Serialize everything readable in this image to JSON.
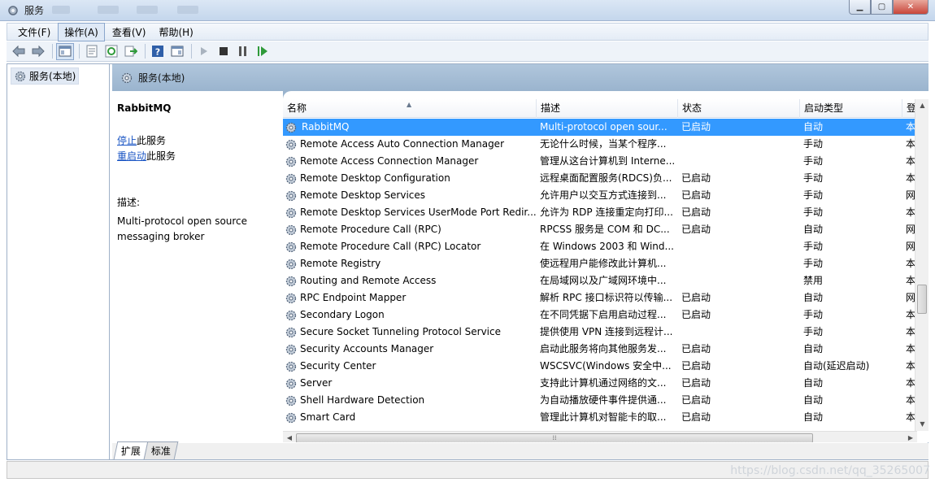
{
  "window": {
    "title": "服务"
  },
  "menu": {
    "items": [
      "文件(F)",
      "操作(A)",
      "查看(V)",
      "帮助(H)"
    ]
  },
  "tree": {
    "root_label": "服务(本地)"
  },
  "content": {
    "header_title": "服务(本地)"
  },
  "detail": {
    "service_name": "RabbitMQ",
    "stop_link": "停止",
    "stop_suffix": "此服务",
    "restart_link": "重启动",
    "restart_suffix": "此服务",
    "desc_label": "描述:",
    "desc_line1": "Multi-protocol open source",
    "desc_line2": "messaging broker"
  },
  "columns": [
    "名称",
    "描述",
    "状态",
    "启动类型",
    "登"
  ],
  "services": [
    {
      "name": "RabbitMQ",
      "desc": "Multi-protocol open sour...",
      "status": "已启动",
      "start": "自动",
      "logon": "本",
      "selected": true
    },
    {
      "name": "Remote Access Auto Connection Manager",
      "desc": "无论什么时候，当某个程序...",
      "status": "",
      "start": "手动",
      "logon": "本"
    },
    {
      "name": "Remote Access Connection Manager",
      "desc": "管理从这台计算机到 Interne...",
      "status": "",
      "start": "手动",
      "logon": "本"
    },
    {
      "name": "Remote Desktop Configuration",
      "desc": "远程桌面配置服务(RDCS)负...",
      "status": "已启动",
      "start": "手动",
      "logon": "本"
    },
    {
      "name": "Remote Desktop Services",
      "desc": "允许用户以交互方式连接到...",
      "status": "已启动",
      "start": "手动",
      "logon": "网"
    },
    {
      "name": "Remote Desktop Services UserMode Port Redir...",
      "desc": "允许为 RDP 连接重定向打印...",
      "status": "已启动",
      "start": "手动",
      "logon": "本"
    },
    {
      "name": "Remote Procedure Call (RPC)",
      "desc": "RPCSS 服务是 COM 和 DC...",
      "status": "已启动",
      "start": "自动",
      "logon": "网"
    },
    {
      "name": "Remote Procedure Call (RPC) Locator",
      "desc": "在 Windows 2003 和 Wind...",
      "status": "",
      "start": "手动",
      "logon": "网"
    },
    {
      "name": "Remote Registry",
      "desc": "使远程用户能修改此计算机...",
      "status": "",
      "start": "手动",
      "logon": "本"
    },
    {
      "name": "Routing and Remote Access",
      "desc": "在局域网以及广域网环境中...",
      "status": "",
      "start": "禁用",
      "logon": "本"
    },
    {
      "name": "RPC Endpoint Mapper",
      "desc": "解析 RPC 接口标识符以传输...",
      "status": "已启动",
      "start": "自动",
      "logon": "网"
    },
    {
      "name": "Secondary Logon",
      "desc": "在不同凭据下启用启动过程...",
      "status": "已启动",
      "start": "手动",
      "logon": "本"
    },
    {
      "name": "Secure Socket Tunneling Protocol Service",
      "desc": "提供使用 VPN 连接到远程计...",
      "status": "",
      "start": "手动",
      "logon": "本"
    },
    {
      "name": "Security Accounts Manager",
      "desc": "启动此服务将向其他服务发...",
      "status": "已启动",
      "start": "自动",
      "logon": "本"
    },
    {
      "name": "Security Center",
      "desc": "WSCSVC(Windows 安全中...",
      "status": "已启动",
      "start": "自动(延迟启动)",
      "logon": "本"
    },
    {
      "name": "Server",
      "desc": "支持此计算机通过网络的文...",
      "status": "已启动",
      "start": "自动",
      "logon": "本"
    },
    {
      "name": "Shell Hardware Detection",
      "desc": "为自动播放硬件事件提供通...",
      "status": "已启动",
      "start": "自动",
      "logon": "本"
    },
    {
      "name": "Smart Card",
      "desc": "管理此计算机对智能卡的取...",
      "status": "已启动",
      "start": "自动",
      "logon": "本"
    }
  ],
  "tabs": [
    "扩展",
    "标准"
  ],
  "watermark": "https://blog.csdn.net/qq_35265007",
  "colors": {
    "selection": "#3399ff",
    "link": "#1a55c4",
    "header_band": "#9ab4ce"
  }
}
